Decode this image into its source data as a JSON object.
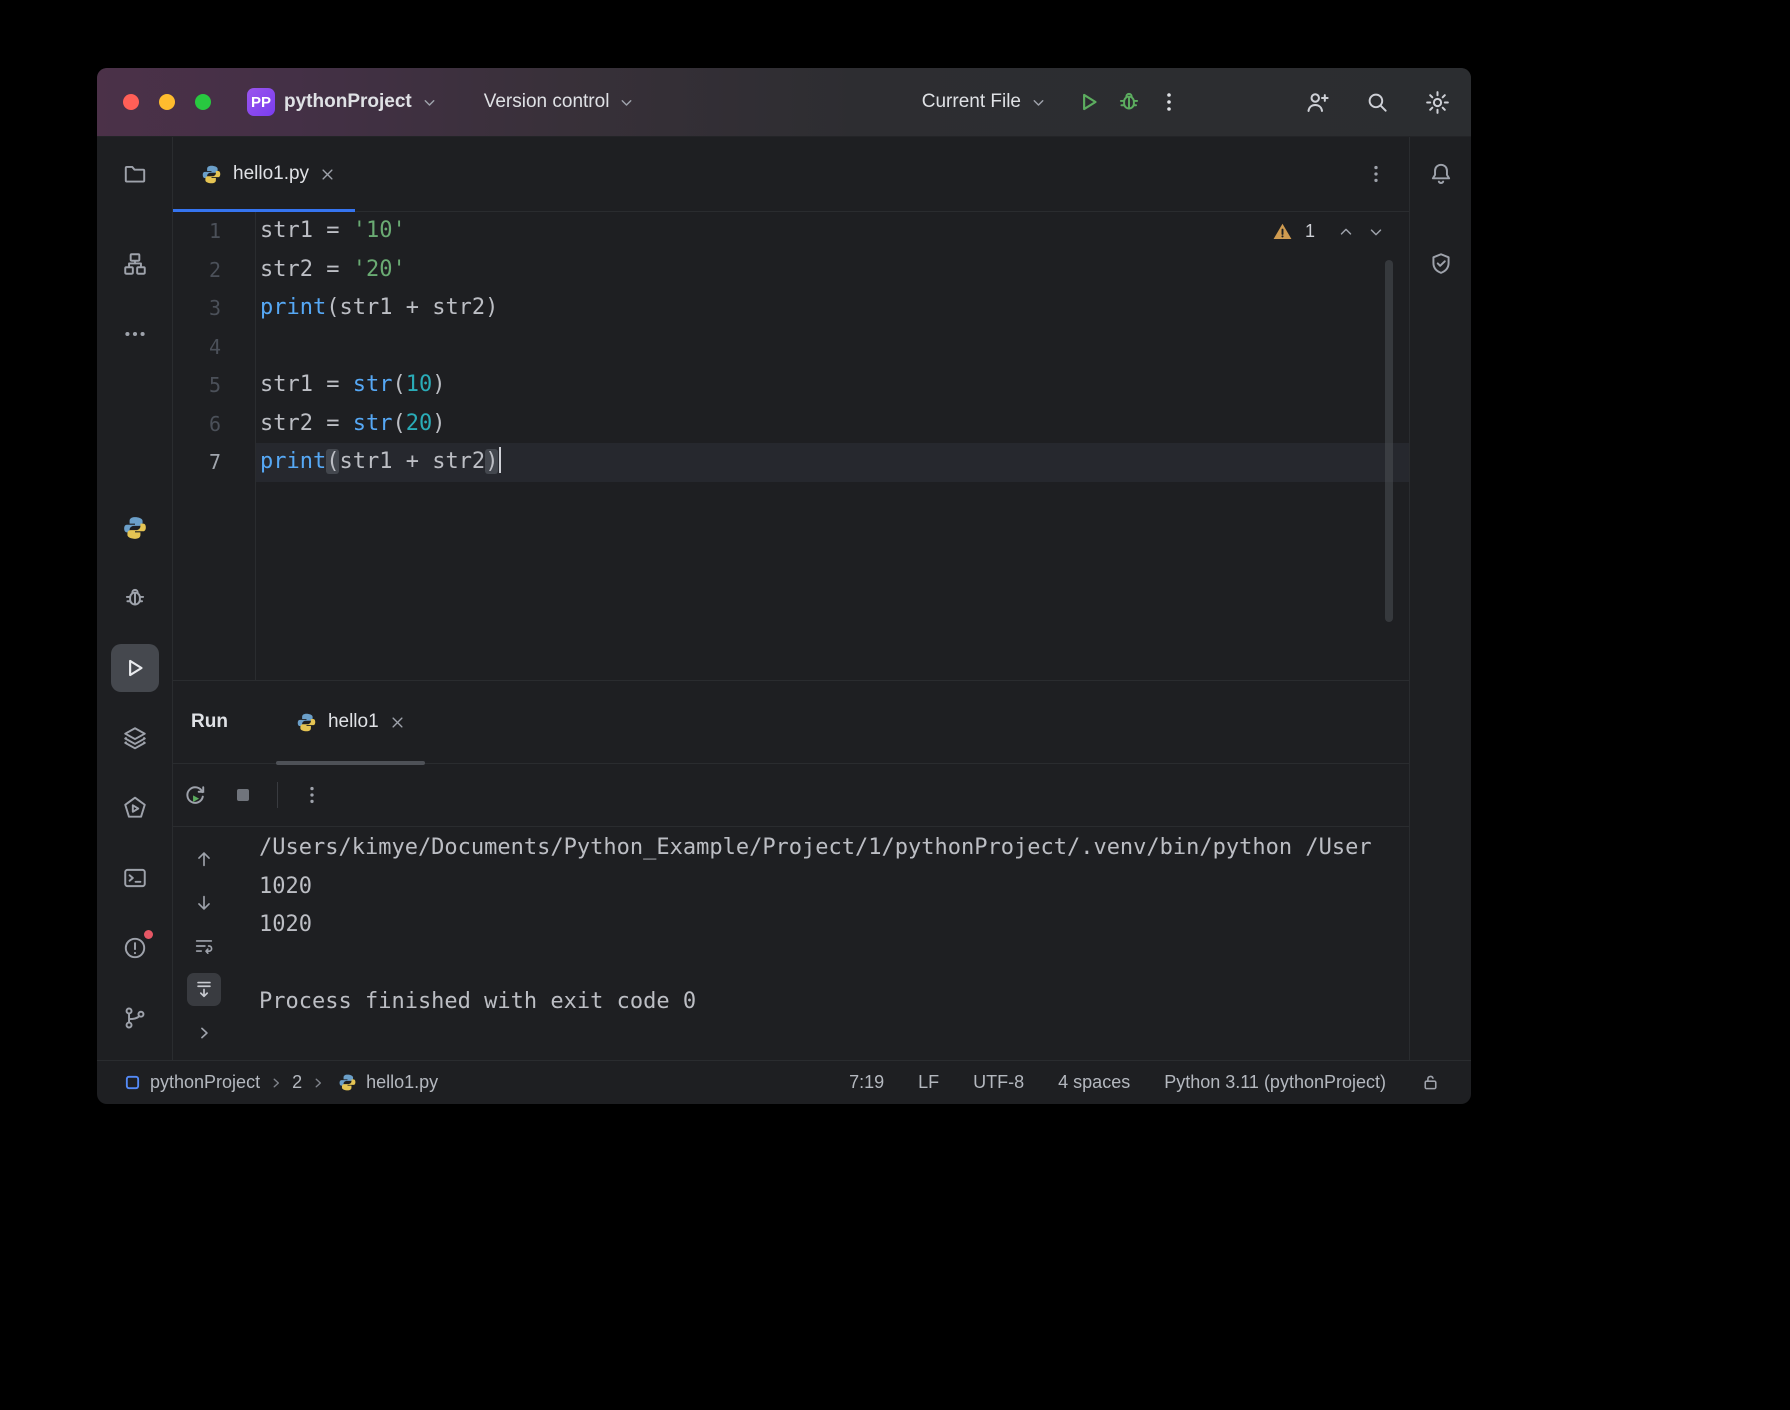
{
  "titlebar": {
    "project_badge": "PP",
    "project_name": "pythonProject",
    "version_control_label": "Version control",
    "run_config_label": "Current File"
  },
  "editor": {
    "tab_label": "hello1.py",
    "inspections": {
      "warning_count": "1"
    },
    "lines": [
      {
        "num": "1",
        "tokens": [
          {
            "text": "str1 = ",
            "type": "plain"
          },
          {
            "text": "'10'",
            "type": "string"
          }
        ]
      },
      {
        "num": "2",
        "tokens": [
          {
            "text": "str2 = ",
            "type": "plain"
          },
          {
            "text": "'20'",
            "type": "string"
          }
        ]
      },
      {
        "num": "3",
        "tokens": [
          {
            "text": "print",
            "type": "func"
          },
          {
            "text": "(str1 + str2)",
            "type": "plain"
          }
        ]
      },
      {
        "num": "4",
        "tokens": []
      },
      {
        "num": "5",
        "tokens": [
          {
            "text": "str1 = ",
            "type": "plain"
          },
          {
            "text": "str",
            "type": "func"
          },
          {
            "text": "(",
            "type": "plain"
          },
          {
            "text": "10",
            "type": "number"
          },
          {
            "text": ")",
            "type": "plain"
          }
        ]
      },
      {
        "num": "6",
        "tokens": [
          {
            "text": "str2 = ",
            "type": "plain"
          },
          {
            "text": "str",
            "type": "func"
          },
          {
            "text": "(",
            "type": "plain"
          },
          {
            "text": "20",
            "type": "number"
          },
          {
            "text": ")",
            "type": "plain"
          }
        ]
      },
      {
        "num": "7",
        "current": true,
        "caret": true,
        "tokens": [
          {
            "text": "print",
            "type": "func"
          },
          {
            "text": "(",
            "type": "plain",
            "hl": true
          },
          {
            "text": "str1 + str2",
            "type": "plain"
          },
          {
            "text": ")",
            "type": "plain",
            "hl": true
          }
        ]
      }
    ]
  },
  "run_panel": {
    "title": "Run",
    "tab_label": "hello1",
    "console_lines": [
      "/Users/kimye/Documents/Python_Example/Project/1/pythonProject/.venv/bin/python /User",
      "1020",
      "1020",
      "",
      "Process finished with exit code 0"
    ]
  },
  "statusbar": {
    "crumbs": {
      "project": "pythonProject",
      "folder": "2",
      "file": "hello1.py"
    },
    "cursor_position": "7:19",
    "line_separator": "LF",
    "encoding": "UTF-8",
    "indent": "4 spaces",
    "interpreter": "Python 3.11 (pythonProject)"
  },
  "colors": {
    "accent_blue": "#3574f0",
    "string_green": "#6aab73",
    "number_teal": "#2aacb8",
    "call_blue": "#56a8f5",
    "run_green": "#5cad5f",
    "warning_gold": "#cf9b50",
    "titlebar_purple": "#4b3148"
  }
}
